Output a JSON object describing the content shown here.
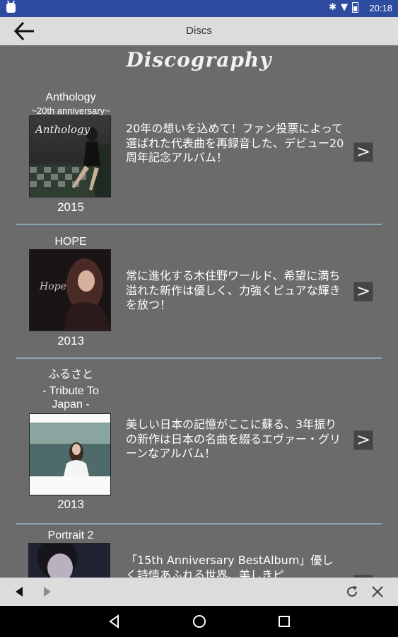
{
  "status_bar": {
    "time": "20:18"
  },
  "toolbar": {
    "title": "Discs"
  },
  "heading": "Discography",
  "albums": [
    {
      "title": "Anthology",
      "subtitle": "~20th anniversary~",
      "year": "2015",
      "desc": "20年の想いを込めて！ファン投票によって選ばれた代表曲を再録音した、デビュー20周年記念アルバム！",
      "cover_text": "Anthology"
    },
    {
      "title": "HOPE",
      "subtitle": "",
      "year": "2013",
      "desc": "常に進化する木住野ワールド、希望に満ち溢れた新作は優しく、力強くピュアな輝きを放つ！",
      "cover_text": "Hope"
    },
    {
      "title": "ふるさと",
      "subtitle": "- Tribute To Japan -",
      "year": "2013",
      "desc": "美しい日本の記憶がここに蘇る、3年振りの新作は日本の名曲を綴るエヴァー・グリーンなアルバム！",
      "cover_text": ""
    },
    {
      "title": "Portrait 2",
      "subtitle": "",
      "year": "",
      "desc": "「15th Anniversary BestAlbum」優しく詩情あふれる世界、美しきピ",
      "cover_text": ""
    }
  ],
  "colors": {
    "status_bar": "#2d4ca0",
    "content_bg": "#6b6b6b",
    "separator": "#8aa6b0",
    "toolbar_bg": "#dcdcdc"
  }
}
